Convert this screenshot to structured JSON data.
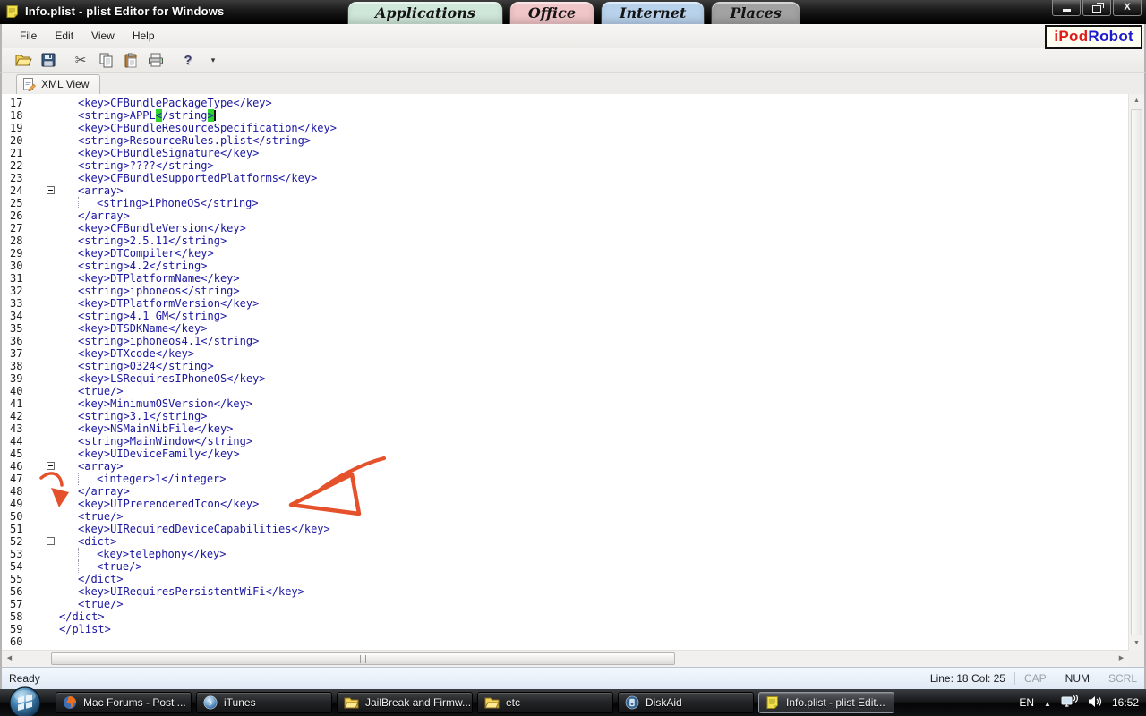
{
  "window": {
    "title": "Info.plist - plist Editor for Windows",
    "controls": [
      {
        "icon": "minimize-icon"
      },
      {
        "icon": "restore-icon"
      },
      {
        "icon": "close-icon"
      }
    ]
  },
  "desktop_tabs": [
    {
      "label": "Applications",
      "color": "#cfe7d9"
    },
    {
      "label": "Office",
      "color": "#f0c6c8"
    },
    {
      "label": "Internet",
      "color": "#b9d2ec"
    },
    {
      "label": "Places",
      "color": "#a2a2a2"
    }
  ],
  "logo": {
    "part1": "iPod",
    "part2": "Robot",
    "ipod_color": "#e01b1b",
    "robot_color": "#1b1bd0"
  },
  "menu": {
    "items": [
      "File",
      "Edit",
      "View",
      "Help"
    ]
  },
  "toolbar": {
    "groups": [
      [
        "open-folder-icon",
        "save-icon"
      ],
      [
        "cut-icon",
        "copy-icon",
        "paste-icon",
        "print-icon"
      ],
      [
        "help-icon",
        "dropdown-arrow-icon"
      ]
    ]
  },
  "view_tab": {
    "label": "XML View",
    "icon": "xml-view-icon"
  },
  "editor": {
    "highlight_color": "#2fd32f",
    "lines": [
      {
        "n": 17,
        "ind": 1,
        "t": "<key>CFBundlePackageType</key>"
      },
      {
        "n": 18,
        "ind": 1,
        "seg": [
          {
            "t": "<string>APPL"
          },
          {
            "t": "<",
            "h": true
          },
          {
            "t": "/string"
          },
          {
            "t": ">",
            "h": true
          }
        ],
        "caret": true
      },
      {
        "n": 19,
        "ind": 1,
        "t": "<key>CFBundleResourceSpecification</key>"
      },
      {
        "n": 20,
        "ind": 1,
        "t": "<string>ResourceRules.plist</string>"
      },
      {
        "n": 21,
        "ind": 1,
        "t": "<key>CFBundleSignature</key>"
      },
      {
        "n": 22,
        "ind": 1,
        "t": "<string>????</string>"
      },
      {
        "n": 23,
        "ind": 1,
        "t": "<key>CFBundleSupportedPlatforms</key>"
      },
      {
        "n": 24,
        "ind": 1,
        "t": "<array>",
        "fold": true
      },
      {
        "n": 25,
        "ind": 2,
        "t": "<string>iPhoneOS</string>",
        "g": true
      },
      {
        "n": 26,
        "ind": 1,
        "t": "</array>"
      },
      {
        "n": 27,
        "ind": 1,
        "t": "<key>CFBundleVersion</key>"
      },
      {
        "n": 28,
        "ind": 1,
        "t": "<string>2.5.11</string>"
      },
      {
        "n": 29,
        "ind": 1,
        "t": "<key>DTCompiler</key>"
      },
      {
        "n": 30,
        "ind": 1,
        "t": "<string>4.2</string>"
      },
      {
        "n": 31,
        "ind": 1,
        "t": "<key>DTPlatformName</key>"
      },
      {
        "n": 32,
        "ind": 1,
        "t": "<string>iphoneos</string>"
      },
      {
        "n": 33,
        "ind": 1,
        "t": "<key>DTPlatformVersion</key>"
      },
      {
        "n": 34,
        "ind": 1,
        "t": "<string>4.1 GM</string>"
      },
      {
        "n": 35,
        "ind": 1,
        "t": "<key>DTSDKName</key>"
      },
      {
        "n": 36,
        "ind": 1,
        "t": "<string>iphoneos4.1</string>"
      },
      {
        "n": 37,
        "ind": 1,
        "t": "<key>DTXcode</key>"
      },
      {
        "n": 38,
        "ind": 1,
        "t": "<string>0324</string>"
      },
      {
        "n": 39,
        "ind": 1,
        "t": "<key>LSRequiresIPhoneOS</key>"
      },
      {
        "n": 40,
        "ind": 1,
        "t": "<true/>"
      },
      {
        "n": 41,
        "ind": 1,
        "t": "<key>MinimumOSVersion</key>"
      },
      {
        "n": 42,
        "ind": 1,
        "t": "<string>3.1</string>"
      },
      {
        "n": 43,
        "ind": 1,
        "t": "<key>NSMainNibFile</key>"
      },
      {
        "n": 44,
        "ind": 1,
        "t": "<string>MainWindow</string>"
      },
      {
        "n": 45,
        "ind": 1,
        "t": "<key>UIDeviceFamily</key>"
      },
      {
        "n": 46,
        "ind": 1,
        "t": "<array>",
        "fold": true
      },
      {
        "n": 47,
        "ind": 2,
        "t": "<integer>1</integer>",
        "g": true
      },
      {
        "n": 48,
        "ind": 1,
        "t": "</array>"
      },
      {
        "n": 49,
        "ind": 1,
        "t": "<key>UIPrerenderedIcon</key>"
      },
      {
        "n": 50,
        "ind": 1,
        "t": "<true/>"
      },
      {
        "n": 51,
        "ind": 1,
        "t": "<key>UIRequiredDeviceCapabilities</key>"
      },
      {
        "n": 52,
        "ind": 1,
        "t": "<dict>",
        "fold": true
      },
      {
        "n": 53,
        "ind": 2,
        "t": "<key>telephony</key>",
        "g": true
      },
      {
        "n": 54,
        "ind": 2,
        "t": "<true/>",
        "g": true
      },
      {
        "n": 55,
        "ind": 1,
        "t": "</dict>"
      },
      {
        "n": 56,
        "ind": 1,
        "t": "<key>UIRequiresPersistentWiFi</key>"
      },
      {
        "n": 57,
        "ind": 1,
        "t": "<true/>"
      },
      {
        "n": 58,
        "ind": 0,
        "t": "</dict>"
      },
      {
        "n": 59,
        "ind": 0,
        "t": "</plist>"
      },
      {
        "n": 60,
        "ind": 0,
        "t": ""
      }
    ]
  },
  "annotations": {
    "arrow_color": "#e4512b"
  },
  "status": {
    "ready": "Ready",
    "line_col": "Line: 18 Col: 25",
    "indicators": [
      {
        "label": "CAP",
        "active": false
      },
      {
        "label": "NUM",
        "active": true
      },
      {
        "label": "SCRL",
        "active": false
      }
    ]
  },
  "taskbar": {
    "buttons": [
      {
        "icon": "firefox-icon",
        "label": "Mac Forums - Post ...",
        "active": false
      },
      {
        "icon": "itunes-icon",
        "label": "iTunes",
        "active": false
      },
      {
        "icon": "folder-icon",
        "label": "JailBreak and Firmw...",
        "active": false
      },
      {
        "icon": "folder-icon",
        "label": "etc",
        "active": false
      },
      {
        "icon": "diskaid-icon",
        "label": "DiskAid",
        "active": false
      },
      {
        "icon": "plist-icon",
        "label": "Info.plist - plist Edit...",
        "active": true
      }
    ],
    "tray": {
      "language": "EN",
      "icons": [
        "up-arrow-icon",
        "network-icon",
        "volume-icon"
      ],
      "clock": "16:52"
    }
  }
}
